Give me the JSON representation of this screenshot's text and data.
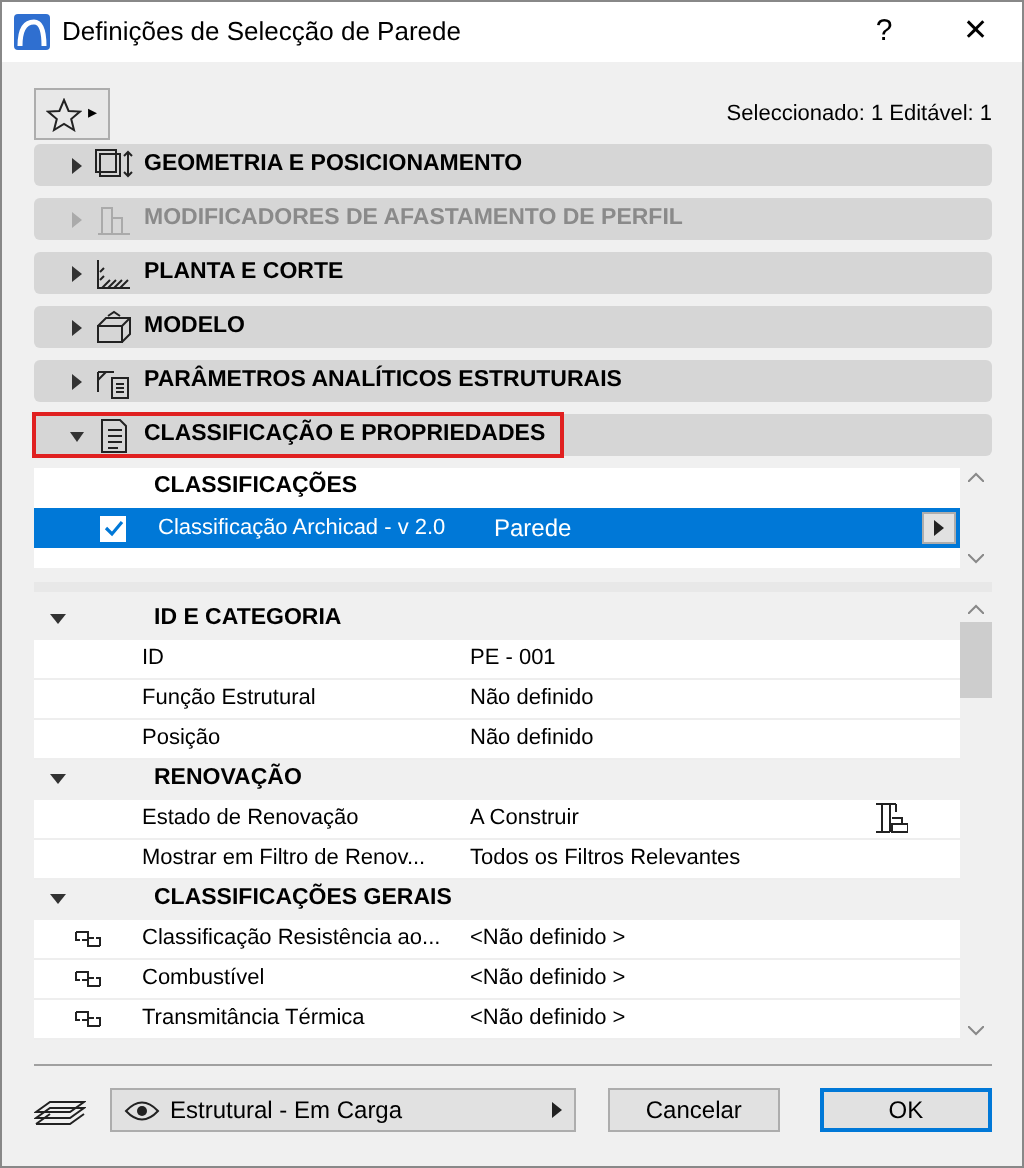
{
  "window": {
    "title": "Definições de Selecção de Parede",
    "help": "?",
    "close": "✕"
  },
  "favorites": {
    "arrow": "▸"
  },
  "selection_info": "Seleccionado: 1 Editável: 1",
  "panels": [
    {
      "label": "GEOMETRIA E POSICIONAMENTO",
      "kind": "geometry",
      "expanded": false,
      "disabled": false,
      "highlighted": false
    },
    {
      "label": "MODIFICADORES DE AFASTAMENTO DE PERFIL",
      "kind": "profile",
      "expanded": false,
      "disabled": true,
      "highlighted": false
    },
    {
      "label": "PLANTA E CORTE",
      "kind": "plan",
      "expanded": false,
      "disabled": false,
      "highlighted": false
    },
    {
      "label": "MODELO",
      "kind": "model",
      "expanded": false,
      "disabled": false,
      "highlighted": false
    },
    {
      "label": "PARÂMETROS ANALÍTICOS ESTRUTURAIS",
      "kind": "structural",
      "expanded": false,
      "disabled": false,
      "highlighted": false
    },
    {
      "label": "CLASSIFICAÇÃO E PROPRIEDADES",
      "kind": "properties",
      "expanded": true,
      "disabled": false,
      "highlighted": true
    }
  ],
  "classifications": {
    "heading": "CLASSIFICAÇÕES",
    "rows": [
      {
        "system": "Classificação Archicad - v 2.0",
        "value": "Parede",
        "checked": true,
        "selected": true
      }
    ]
  },
  "properties": [
    {
      "group": "ID E CATEGORIA",
      "expanded": true,
      "items": [
        {
          "name": "ID",
          "value": "PE - 001",
          "linked": false
        },
        {
          "name": "Função Estrutural",
          "value": "Não definido",
          "linked": false
        },
        {
          "name": "Posição",
          "value": "Não definido",
          "linked": false
        }
      ]
    },
    {
      "group": "RENOVAÇÃO",
      "expanded": true,
      "items": [
        {
          "name": "Estado de Renovação",
          "value": "A Construir",
          "linked": false,
          "kind": "renovation"
        },
        {
          "name": "Mostrar em Filtro de Renov...",
          "value": "Todos os Filtros Relevantes",
          "linked": false
        }
      ]
    },
    {
      "group": "CLASSIFICAÇÕES GERAIS",
      "expanded": true,
      "items": [
        {
          "name": "Classificação Resistência ao...",
          "value": "<Não definido >",
          "linked": true
        },
        {
          "name": "Combustível",
          "value": "<Não definido >",
          "linked": true
        },
        {
          "name": "Transmitância Térmica",
          "value": "<Não definido >",
          "linked": true
        }
      ]
    }
  ],
  "footer": {
    "layer": "Estrutural - Em Carga",
    "buttons": [
      {
        "label": "Cancelar",
        "default": false
      },
      {
        "label": "OK",
        "default": true
      }
    ]
  }
}
